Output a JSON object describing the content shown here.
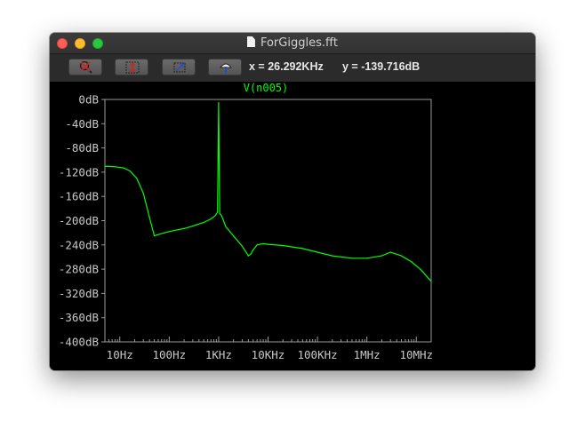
{
  "window": {
    "title": "ForGiggles.fft"
  },
  "toolbar": {
    "buttons": [
      {
        "name": "zoom-out-icon"
      },
      {
        "name": "autorange-y-icon"
      },
      {
        "name": "zoom-full-icon"
      },
      {
        "name": "pan-icon"
      }
    ],
    "x_readout": "x = 26.292KHz",
    "y_readout": "y = -139.716dB"
  },
  "colors": {
    "trace": "#00ff00",
    "background": "#000000",
    "axis_text": "#c8c8c8"
  },
  "chart_data": {
    "type": "line",
    "title": "V(n005)",
    "xscale": "log",
    "xlim": [
      5,
      20000000
    ],
    "ylim": [
      -400,
      0
    ],
    "x_tick_labels": [
      "10Hz",
      "100Hz",
      "1KHz",
      "10KHz",
      "100KHz",
      "1MHz",
      "10MHz"
    ],
    "x_ticks": [
      10,
      100,
      1000,
      10000,
      100000,
      1000000,
      10000000
    ],
    "y_tick_labels": [
      "0dB",
      "-40dB",
      "-80dB",
      "-120dB",
      "-160dB",
      "-200dB",
      "-240dB",
      "-280dB",
      "-320dB",
      "-360dB",
      "-400dB"
    ],
    "y_ticks": [
      0,
      -40,
      -80,
      -120,
      -160,
      -200,
      -240,
      -280,
      -320,
      -360,
      -400
    ],
    "series": [
      {
        "name": "V(n005)",
        "x": [
          5,
          8,
          12,
          16,
          22,
          30,
          40,
          50,
          60,
          80,
          100,
          150,
          200,
          300,
          500,
          700,
          850,
          950,
          1000,
          1050,
          1150,
          1400,
          2000,
          3000,
          4000,
          4500,
          5000,
          6000,
          8000,
          10000,
          20000,
          50000,
          100000,
          200000,
          500000,
          1000000,
          2000000,
          3000000,
          5000000,
          8000000,
          12000000,
          20000000
        ],
        "y": [
          -110,
          -111,
          -113,
          -118,
          -130,
          -155,
          -195,
          -225,
          -223,
          -220,
          -218,
          -215,
          -213,
          -209,
          -203,
          -197,
          -192,
          -186,
          -5,
          -188,
          -192,
          -210,
          -225,
          -242,
          -258,
          -255,
          -248,
          -240,
          -238,
          -239,
          -241,
          -246,
          -252,
          -258,
          -262,
          -262,
          -258,
          -252,
          -258,
          -268,
          -280,
          -300
        ]
      }
    ]
  }
}
